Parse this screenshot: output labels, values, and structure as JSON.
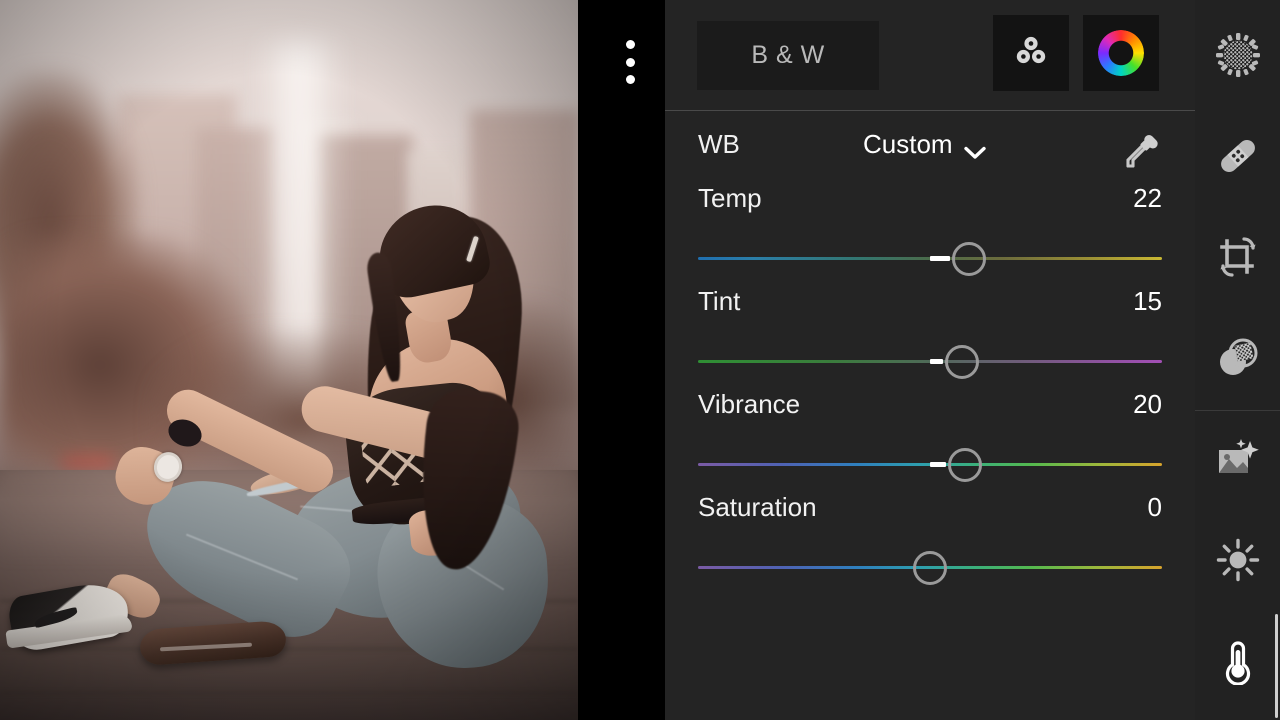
{
  "app": {
    "name": "photo-editor",
    "panel_bg": "#242424",
    "toolbar_bg": "#222222",
    "accent_white": "#ffffff"
  },
  "canvas": {
    "menu_icon": "more-vertical-icon",
    "photo_alt": "Woman in grey ripped jeans and dark argyle crop top sitting on pavement, blurred city buildings behind"
  },
  "header": {
    "bw_label": "B & W",
    "mix_icon": "color-mix-icon",
    "wheel_icon": "color-wheel-icon"
  },
  "wb": {
    "label": "WB",
    "value": "Custom",
    "chevron_icon": "chevron-down-icon",
    "eyedropper_icon": "eyedropper-icon"
  },
  "sliders": [
    {
      "name": "Temp",
      "value": "22",
      "knob_pct": 58.5,
      "fill_start_pct": 50,
      "fill_end_pct": 58.5,
      "track_class": "t-temp",
      "min": -100,
      "max": 100
    },
    {
      "name": "Tint",
      "value": "15",
      "knob_pct": 57,
      "fill_start_pct": 50,
      "fill_end_pct": 57,
      "track_class": "t-tint",
      "min": -100,
      "max": 100
    },
    {
      "name": "Vibrance",
      "value": "20",
      "knob_pct": 57.5,
      "fill_start_pct": 50,
      "fill_end_pct": 57.5,
      "track_class": "t-vib",
      "min": -100,
      "max": 100
    },
    {
      "name": "Saturation",
      "value": "0",
      "knob_pct": 50,
      "fill_start_pct": 50,
      "fill_end_pct": 50,
      "track_class": "t-sat",
      "min": -100,
      "max": 100
    }
  ],
  "toolbar": {
    "items": [
      {
        "name": "healing-texture",
        "icon": "halftone-circle-icon",
        "active": false
      },
      {
        "name": "healing-brush",
        "icon": "bandage-icon",
        "active": false
      },
      {
        "name": "crop-rotate",
        "icon": "crop-rotate-icon",
        "active": false
      },
      {
        "name": "clone-stamp",
        "icon": "clone-stamp-icon",
        "active": false
      },
      {
        "name": "effects",
        "icon": "image-sparkle-icon",
        "active": false
      },
      {
        "name": "light",
        "icon": "sun-icon",
        "active": false
      },
      {
        "name": "color",
        "icon": "thermometer-icon",
        "active": true
      }
    ],
    "scroll_indicator": "vertical-scrollbar"
  }
}
